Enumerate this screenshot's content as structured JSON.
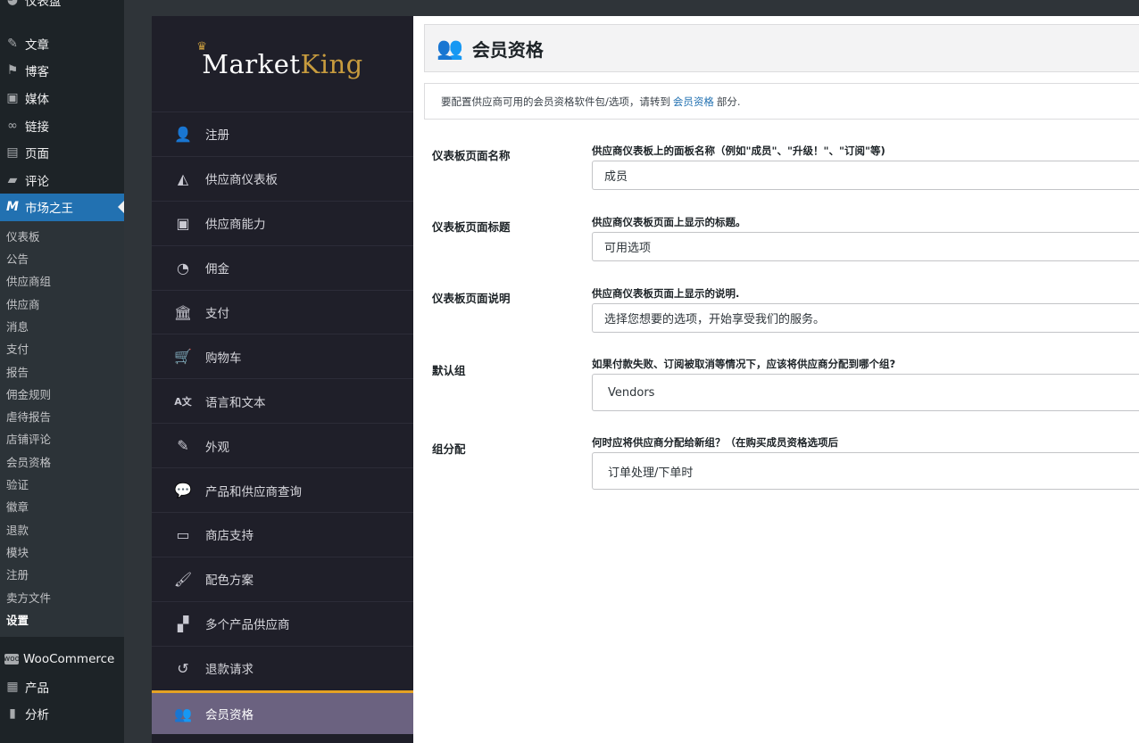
{
  "wp_menu": {
    "items_top": [
      {
        "label": "仪表盘",
        "icon": "dashboard-icon"
      },
      {
        "label": "文章",
        "icon": "pin-icon"
      },
      {
        "label": "博客",
        "icon": "flag-icon"
      },
      {
        "label": "媒体",
        "icon": "media-icon"
      },
      {
        "label": "链接",
        "icon": "link-icon"
      },
      {
        "label": "页面",
        "icon": "page-icon"
      },
      {
        "label": "评论",
        "icon": "comment-icon"
      },
      {
        "label": "市场之王",
        "icon": "marketking-icon"
      }
    ],
    "submenu": [
      "仪表板",
      "公告",
      "供应商组",
      "供应商",
      "消息",
      "支付",
      "报告",
      "佣金规则",
      "虐待报告",
      "店铺评论",
      "会员资格",
      "验证",
      "徽章",
      "退款",
      "模块",
      "注册",
      "卖方文件",
      "设置"
    ],
    "items_bottom": [
      {
        "label": "WooCommerce",
        "icon": "woocommerce-icon"
      },
      {
        "label": "产品",
        "icon": "archive-icon"
      },
      {
        "label": "分析",
        "icon": "chart-icon"
      }
    ]
  },
  "mk_logo": {
    "part1": "Market",
    "part2": "King"
  },
  "mk_menu": [
    {
      "label": "注册",
      "icon": "add-user-icon"
    },
    {
      "label": "供应商仪表板",
      "icon": "area-chart-icon"
    },
    {
      "label": "供应商能力",
      "icon": "id-badge-icon"
    },
    {
      "label": "佣金",
      "icon": "pie-chart-icon"
    },
    {
      "label": "支付",
      "icon": "bank-icon"
    },
    {
      "label": "购物车",
      "icon": "cart-icon"
    },
    {
      "label": "语言和文本",
      "icon": "translate-icon"
    },
    {
      "label": "外观",
      "icon": "edit-icon"
    },
    {
      "label": "产品和供应商查询",
      "icon": "chat-icon"
    },
    {
      "label": "商店支持",
      "icon": "ticket-icon"
    },
    {
      "label": "配色方案",
      "icon": "brush-icon"
    },
    {
      "label": "多个产品供应商",
      "icon": "boxes-icon"
    },
    {
      "label": "退款请求",
      "icon": "undo-icon"
    },
    {
      "label": "会员资格",
      "icon": "users-icon"
    }
  ],
  "page": {
    "title": "会员资格",
    "notice_before": "要配置供应商可用的会员资格软件包/选项，请转到",
    "notice_link": "会员资格",
    "notice_after": "部分."
  },
  "fields": [
    {
      "label": "仪表板页面名称",
      "desc": "供应商仪表板上的面板名称（例如\"成员\"、\"升级！\"、\"订阅\"等)",
      "value": "成员"
    },
    {
      "label": "仪表板页面标题",
      "desc": "供应商仪表板页面上显示的标题。",
      "value": "可用选项"
    },
    {
      "label": "仪表板页面说明",
      "desc": "供应商仪表板页面上显示的说明.",
      "value": "选择您想要的选项，开始享受我们的服务。"
    },
    {
      "label": "默认组",
      "desc": "如果付款失败、订阅被取消等情况下，应该将供应商分配到哪个组?",
      "value": "Vendors"
    },
    {
      "label": "组分配",
      "desc": "何时应将供应商分配给新组？（在购买成员资格选项后",
      "value": "订单处理/下单时"
    }
  ],
  "colors": {
    "wp_sidebar": "#1d2327",
    "wp_active": "#2271b1",
    "mk_panel": "#1f1f29",
    "mk_selected": "#6b6280",
    "mk_accent": "#e5a224"
  }
}
